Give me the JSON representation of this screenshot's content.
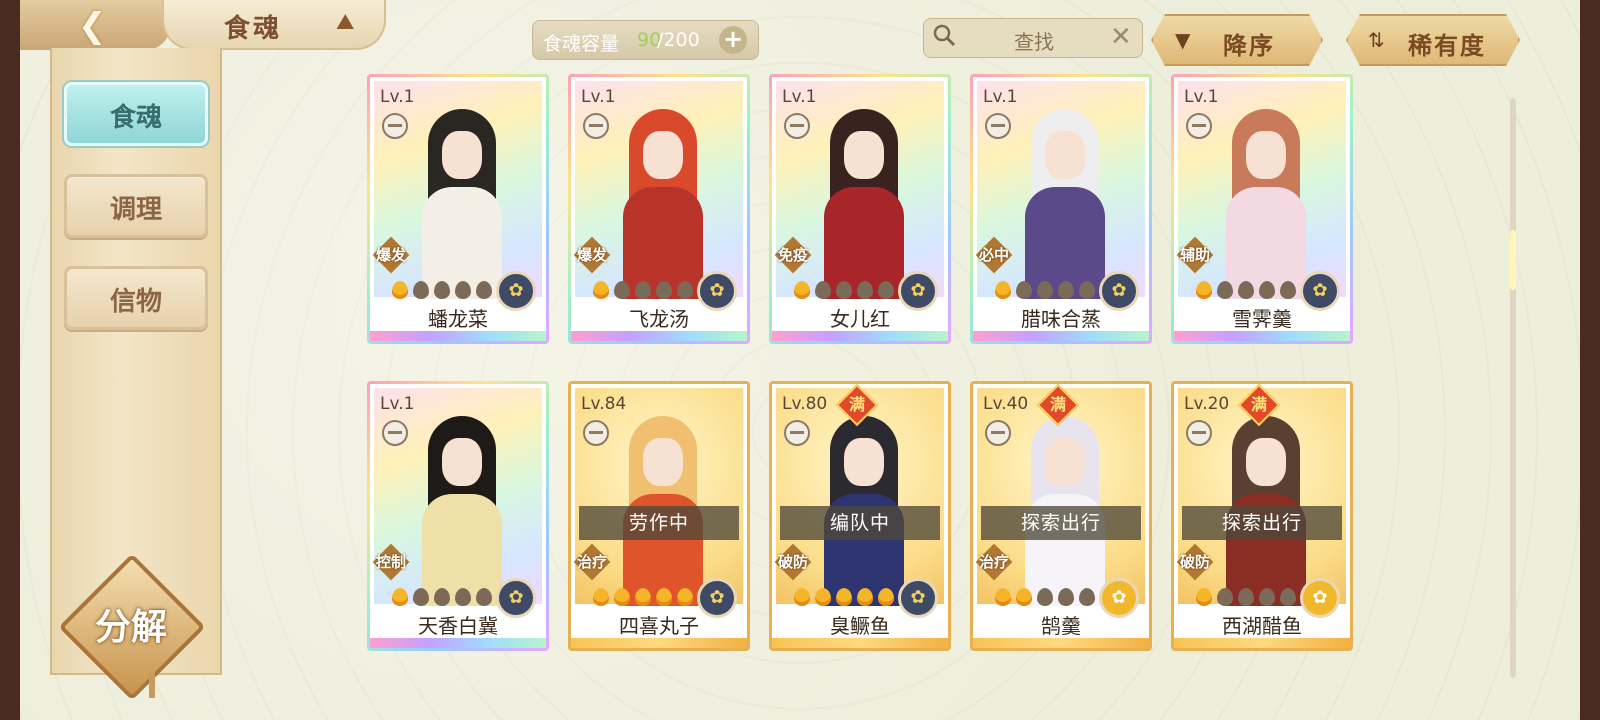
{
  "header": {
    "title": "食魂",
    "capacity_label": "食魂容量",
    "capacity_current": "90",
    "capacity_max": "/200",
    "search_placeholder": "查找",
    "sort_label": "降序",
    "rarity_label": "稀有度"
  },
  "sidebar": {
    "tabs": [
      {
        "label": "食魂",
        "active": true
      },
      {
        "label": "调理",
        "active": false
      },
      {
        "label": "信物",
        "active": false
      }
    ],
    "decompose_label": "分解"
  },
  "cards": [
    {
      "level": "Lv.1",
      "name": "蟠龙菜",
      "role": "爆发",
      "frame": "rainbow",
      "flames": 1,
      "status": "",
      "full_label": "",
      "hair": "#2a2622",
      "body": "#f3efe6"
    },
    {
      "level": "Lv.1",
      "name": "飞龙汤",
      "role": "爆发",
      "frame": "rainbow",
      "flames": 1,
      "status": "",
      "full_label": "",
      "hair": "#d94a2c",
      "body": "#b8332a"
    },
    {
      "level": "Lv.1",
      "name": "女儿红",
      "role": "免疫",
      "frame": "rainbow",
      "flames": 1,
      "status": "",
      "full_label": "",
      "hair": "#3a2220",
      "body": "#a8262a"
    },
    {
      "level": "Lv.1",
      "name": "腊味合蒸",
      "role": "必中",
      "frame": "rainbow",
      "flames": 1,
      "status": "",
      "full_label": "",
      "hair": "#eeeeee",
      "body": "#5b4a8a"
    },
    {
      "level": "Lv.1",
      "name": "雪霁羹",
      "role": "辅助",
      "frame": "rainbow",
      "flames": 1,
      "status": "",
      "full_label": "",
      "hair": "#c87a5a",
      "body": "#f3d9e2"
    },
    {
      "level": "Lv.1",
      "name": "天香白冀",
      "role": "控制",
      "frame": "rainbow",
      "flames": 1,
      "status": "",
      "full_label": "",
      "hair": "#1e1a18",
      "body": "#efe0a8"
    },
    {
      "level": "Lv.84",
      "name": "四喜丸子",
      "role": "治疗",
      "frame": "gold",
      "flames": 5,
      "status": "劳作中",
      "full_label": "",
      "hair": "#f0c070",
      "body": "#e0542c"
    },
    {
      "level": "Lv.80",
      "name": "臭鳜鱼",
      "role": "破防",
      "frame": "gold",
      "flames": 5,
      "status": "编队中",
      "full_label": "满",
      "hair": "#2a2a30",
      "body": "#2e3470"
    },
    {
      "level": "Lv.40",
      "name": "鹄羹",
      "role": "治疗",
      "frame": "gold",
      "flames": 2,
      "status": "探索出行",
      "full_label": "满",
      "hair": "#e8e4ee",
      "body": "#f6f4f8"
    },
    {
      "level": "Lv.20",
      "name": "西湖醋鱼",
      "role": "破防",
      "frame": "gold",
      "flames": 1,
      "status": "探索出行",
      "full_label": "满",
      "hair": "#5a4030",
      "body": "#8a2e24"
    }
  ]
}
